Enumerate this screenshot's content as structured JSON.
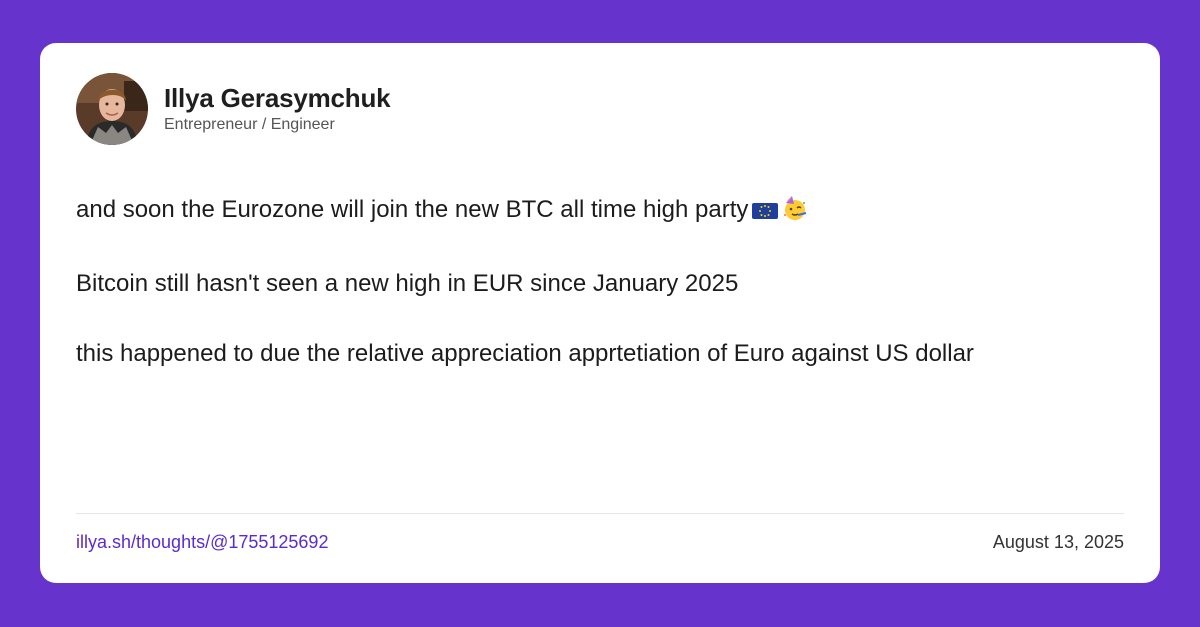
{
  "author": {
    "name": "Illya Gerasymchuk",
    "role": "Entrepreneur / Engineer",
    "avatar_icon": "profile-photo"
  },
  "post": {
    "paragraphs": [
      "and soon the Eurozone will join the new BTC all time high party",
      "Bitcoin still hasn't seen a new high in EUR since January 2025",
      "this happened to due the relative appreciation apprtetiation of Euro against US dollar"
    ],
    "emojis": [
      "eu-flag-icon",
      "partying-face-icon"
    ]
  },
  "footer": {
    "link": "illya.sh/thoughts/@1755125692",
    "date": "August 13, 2025"
  },
  "colors": {
    "background": "#6633cc",
    "card": "#ffffff",
    "link": "#5a2bd0"
  }
}
